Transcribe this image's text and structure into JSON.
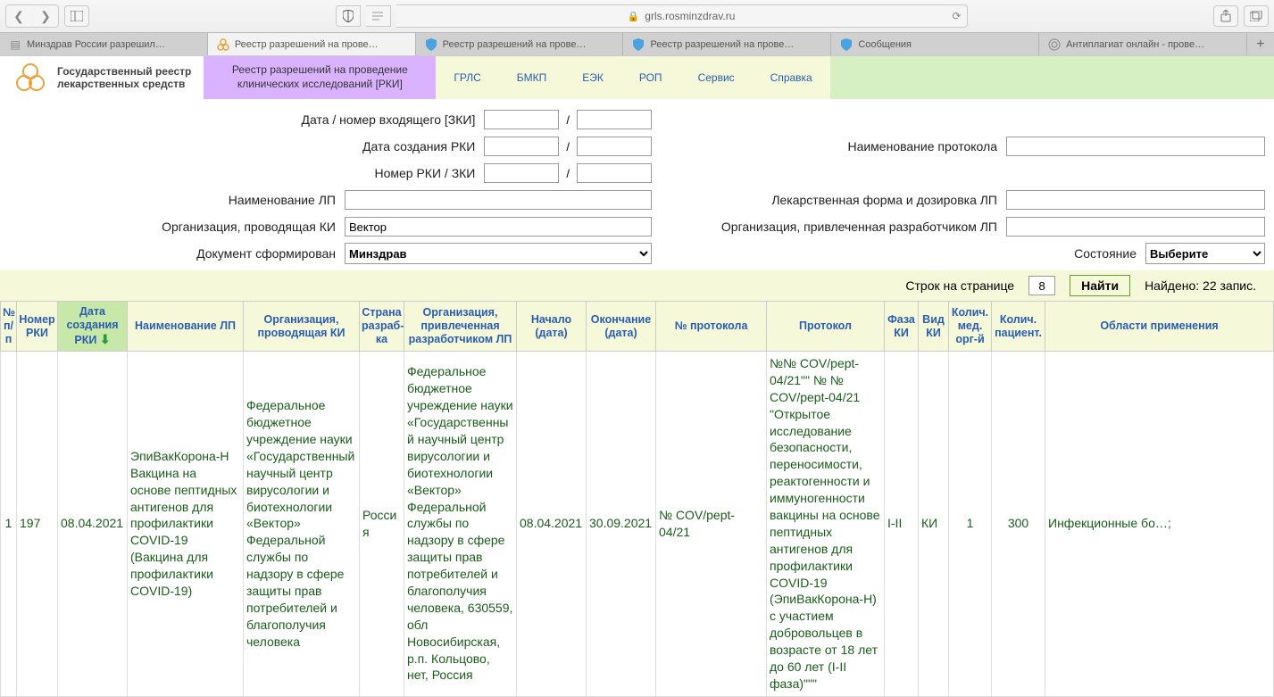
{
  "browser": {
    "url": "grls.rosminzdrav.ru",
    "tabs": [
      {
        "label": "Минздрав России разрешил…",
        "iconColor": "#888"
      },
      {
        "label": "Реестр разрешений на прове…",
        "iconColor": "#e8a33d",
        "active": true
      },
      {
        "label": "Реестр разрешений на прове…",
        "iconColor": "#4aa3e0"
      },
      {
        "label": "Реестр разрешений на прове…",
        "iconColor": "#4aa3e0"
      },
      {
        "label": "Сообщения",
        "iconColor": "#4aa3e0"
      },
      {
        "label": "Антиплагиат онлайн - прове…",
        "iconColor": "#888"
      }
    ]
  },
  "site": {
    "title1": "Государственный реестр",
    "title2": "лекарственных средств",
    "menu": {
      "active": "Реестр разрешений на проведение клинических исследований [РКИ]",
      "items": [
        "ГРЛС",
        "БМКП",
        "ЕЭК",
        "РОП",
        "Сервис",
        "Справка"
      ]
    }
  },
  "filters": {
    "l_incoming": "Дата / номер входящего [ЗКИ]",
    "l_created": "Дата создания РКИ",
    "l_rkizki": "Номер РКИ / ЗКИ",
    "l_lpname": "Наименование ЛП",
    "l_org": "Организация, проводящая КИ",
    "v_org": "Вектор",
    "l_doc": "Документ сформирован",
    "v_doc": "Минздрав",
    "l_protname": "Наименование протокола",
    "l_form": "Лекарственная форма и дозировка ЛП",
    "l_devorg": "Организация, привлеченная разработчиком ЛП",
    "l_state": "Состояние",
    "v_state": "Выберите"
  },
  "actionbar": {
    "rows_label": "Строк на странице",
    "rows_value": "8",
    "find": "Найти",
    "found": "Найдено: 22 запис."
  },
  "table": {
    "headers": {
      "idx": "№ п/п",
      "num": "Номер РКИ",
      "date": "Дата создания РКИ",
      "name": "Наименование ЛП",
      "org": "Организация, проводящая КИ",
      "country": "Страна разраб-ка",
      "devorg": "Организация, привлеченная разработчиком ЛП",
      "start": "Начало (дата)",
      "end": "Окончание (дата)",
      "protnum": "№ протокола",
      "prot": "Протокол",
      "phase": "Фаза КИ",
      "type": "Вид КИ",
      "medorg": "Колич. мед. орг-й",
      "pat": "Колич. пациент.",
      "area": "Области применения"
    },
    "rows": [
      {
        "idx": "1",
        "num": "197",
        "date": "08.04.2021",
        "name": "ЭпиВакКорона-Н Вакцина на основе пептидных антигенов для профилактики COVID-19 (Вакцина для профилактики COVID-19)",
        "org": "Федеральное бюджетное учреждение науки «Государственный научный центр вирусологии и биотехнологии «Вектор» Федеральной службы по надзору в сфере защиты прав потребителей и благополучия человека",
        "country": "Россия",
        "devorg": "Федеральное бюджетное учреждение науки «Государственный научный центр вирусологии и биотехнологии «Вектор» Федеральной службы по надзору в сфере защиты прав потребителей и благополучия человека, 630559, обл Новосибирская, р.п. Кольцово, нет, Россия",
        "start": "08.04.2021",
        "end": "30.09.2021",
        "protnum": "№ COV/pept-04/21",
        "prot": "№№ COV/pept-04/21\"\" № № COV/pept-04/21 \"Открытое исследование безопасности, переносимости, реактогенности и иммуногенности вакцины на основе пептидных антигенов для профилактики COVID-19 (ЭпиВакКорона-Н) с участием добровольцев в возрасте от 18 лет до 60 лет (I-II фаза)\"\"\"",
        "phase": "I-II",
        "type": "КИ",
        "medorg": "1",
        "pat": "300",
        "area": "Инфекционные бо…;"
      }
    ]
  }
}
